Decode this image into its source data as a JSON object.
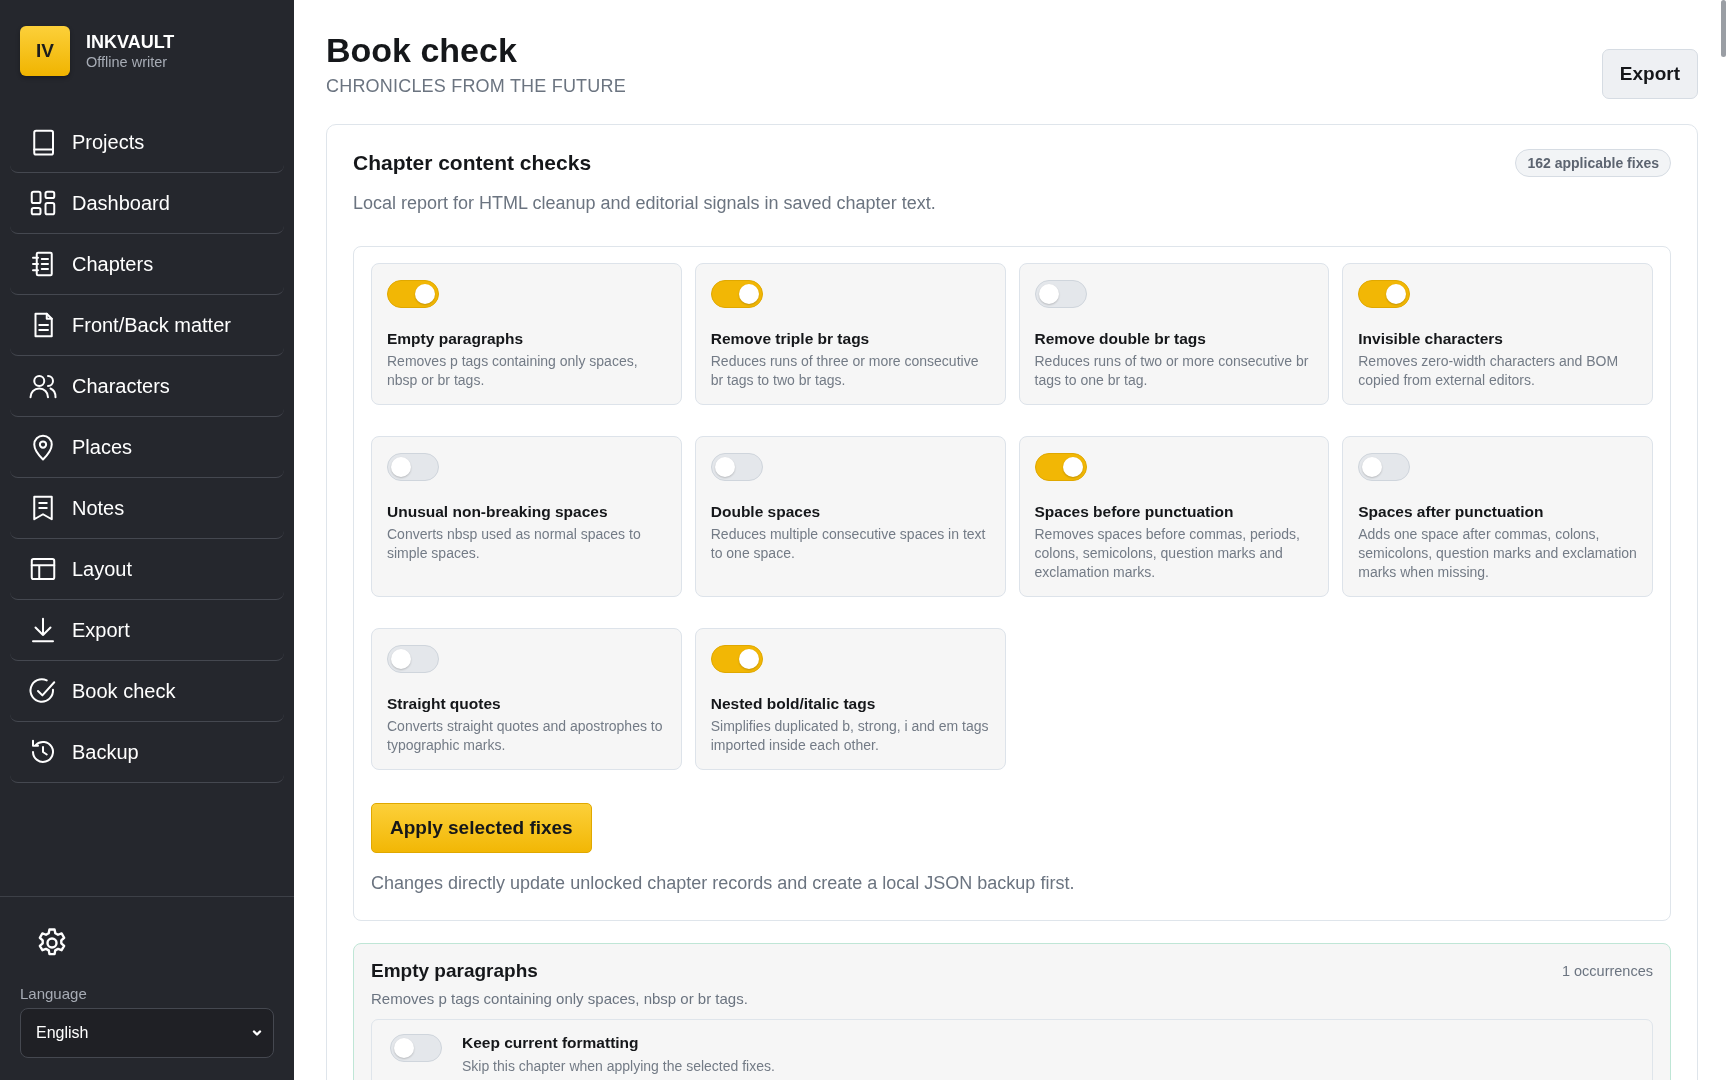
{
  "sidebar": {
    "brand": {
      "logo": "IV",
      "name": "INKVAULT",
      "tagline": "Offline writer"
    },
    "items": [
      {
        "label": "Projects"
      },
      {
        "label": "Dashboard"
      },
      {
        "label": "Chapters"
      },
      {
        "label": "Front/Back matter"
      },
      {
        "label": "Characters"
      },
      {
        "label": "Places"
      },
      {
        "label": "Notes"
      },
      {
        "label": "Layout"
      },
      {
        "label": "Export"
      },
      {
        "label": "Book check"
      },
      {
        "label": "Backup"
      }
    ],
    "language": {
      "label": "Language",
      "value": "English"
    }
  },
  "header": {
    "title": "Book check",
    "subtitle": "CHRONICLES FROM THE FUTURE",
    "export_button": "Export"
  },
  "checks_panel": {
    "title": "Chapter content checks",
    "badge": "162 applicable fixes",
    "description": "Local report for HTML cleanup and editorial signals in saved chapter text.",
    "checks": [
      {
        "title": "Empty paragraphs",
        "description": "Removes p tags containing only spaces, nbsp or br tags.",
        "on": true
      },
      {
        "title": "Remove triple br tags",
        "description": "Reduces runs of three or more consecutive br tags to two br tags.",
        "on": true
      },
      {
        "title": "Remove double br tags",
        "description": "Reduces runs of two or more consecutive br tags to one br tag.",
        "on": false
      },
      {
        "title": "Invisible characters",
        "description": "Removes zero-width characters and BOM copied from external editors.",
        "on": true
      },
      {
        "title": "Unusual non-breaking spaces",
        "description": "Converts nbsp used as normal spaces to simple spaces.",
        "on": false
      },
      {
        "title": "Double spaces",
        "description": "Reduces multiple consecutive spaces in text to one space.",
        "on": false
      },
      {
        "title": "Spaces before punctuation",
        "description": "Removes spaces before commas, periods, colons, semicolons, question marks and exclamation marks.",
        "on": true
      },
      {
        "title": "Spaces after punctuation",
        "description": "Adds one space after commas, colons, semicolons, question marks and exclamation marks when missing.",
        "on": false
      },
      {
        "title": "Straight quotes",
        "description": "Converts straight quotes and apostrophes to typographic marks.",
        "on": false
      },
      {
        "title": "Nested bold/italic tags",
        "description": "Simplifies duplicated b, strong, i and em tags imported inside each other.",
        "on": true
      }
    ],
    "apply_button": "Apply selected fixes",
    "note": "Changes directly update unlocked chapter records and create a local JSON backup first."
  },
  "occurrences": [
    {
      "title": "Empty paragraphs",
      "count": "1 occurrences",
      "description": "Removes p tags containing only spaces, nbsp or br tags.",
      "option": {
        "label": "Keep current formatting",
        "hint": "Skip this chapter when applying the selected fixes.",
        "on": false
      }
    }
  ]
}
